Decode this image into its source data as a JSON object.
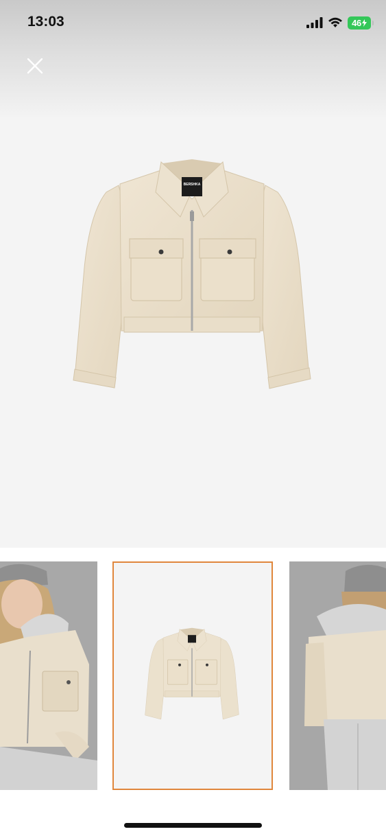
{
  "status_bar": {
    "time": "13:03",
    "battery_level": "46",
    "battery_color": "#34c759",
    "icons": [
      "signal-icon",
      "wifi-icon",
      "battery-icon"
    ]
  },
  "toolbar": {
    "close_icon": "close-icon"
  },
  "gallery": {
    "main_image": "jacket-product-image",
    "main_label": "BERSHKA",
    "thumbnails": [
      {
        "image": "model-front-photo",
        "selected": false
      },
      {
        "image": "jacket-product-image",
        "selected": true
      },
      {
        "image": "model-back-photo",
        "selected": false
      }
    ],
    "selected_border_color": "#e0863b"
  }
}
